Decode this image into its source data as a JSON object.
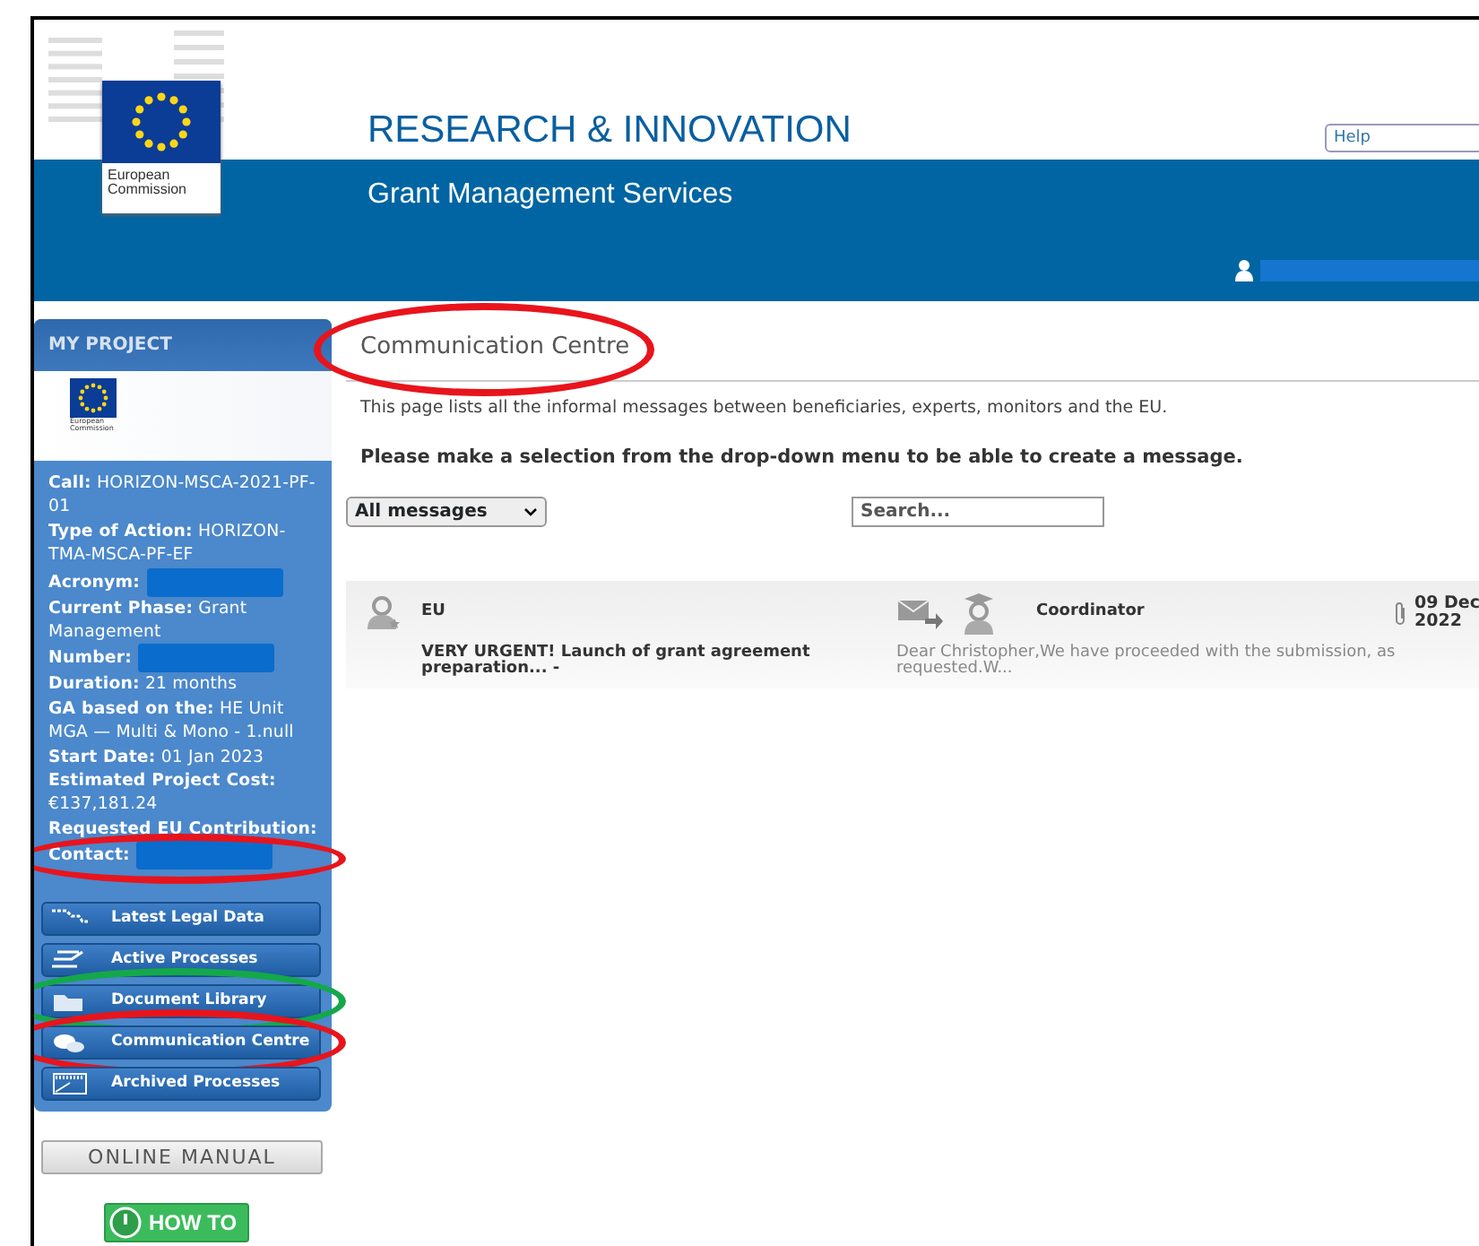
{
  "header": {
    "title": "RESEARCH & INNOVATION",
    "subtitle": "Grant Management Services",
    "logo_text": "European Commission",
    "help": "Help"
  },
  "sidebar": {
    "title": "MY PROJECT",
    "logo_text": "European Commission",
    "info": [
      {
        "text": "**Call:** HORIZON-MSCA-2021-PF-01",
        "redacted": false
      },
      {
        "text": "**Type of Action:** HORIZON-TMA-MSCA-PF-EF",
        "redacted": false
      },
      {
        "text": "**Acronym:**",
        "redacted": true
      },
      {
        "text": "**Current Phase:** Grant Management",
        "redacted": false
      },
      {
        "text": "**Number:**",
        "redacted": true
      },
      {
        "text": "**Duration:** 21 months",
        "redacted": false
      },
      {
        "text": "**GA based on the:** HE Unit MGA — Multi & Mono - 1.null",
        "redacted": false
      },
      {
        "text": "**Start Date:** 01 Jan 2023",
        "redacted": false
      },
      {
        "text": "**Estimated Project Cost:** €137,181.24",
        "redacted": false
      },
      {
        "text": "**Requested EU Contribution:**",
        "redacted": false
      },
      {
        "text": "**Contact:**",
        "redacted": true,
        "annotation": {
          "color": "#e8141c"
        }
      }
    ],
    "menu": [
      {
        "label": "Latest Legal Data",
        "kind": "legal"
      },
      {
        "label": "Active Processes",
        "kind": "process"
      },
      {
        "label": "Document Library",
        "kind": "folder",
        "annotation": {
          "color": "#14a84a"
        }
      },
      {
        "label": "Communication Centre",
        "kind": "chat",
        "annotation": {
          "color": "#e8141c"
        }
      },
      {
        "label": "Archived Processes",
        "kind": "archive"
      }
    ],
    "manual": "ONLINE MANUAL",
    "howto": "HOW TO"
  },
  "main": {
    "heading": "Communication Centre",
    "heading_annotation": {
      "color": "#e8141c"
    },
    "intro": "This page lists all the informal messages between beneficiaries, experts, monitors and the EU.",
    "instruction": "Please make a selection from the drop-down menu to be able to create a message.",
    "filter": "All messages",
    "search": {
      "placeholder": "Search..."
    },
    "messages": [
      {
        "from": "EU",
        "to": "Coordinator",
        "date": "09 Dec 2022",
        "attachment": true,
        "subject": "VERY URGENT! Launch of grant agreement preparation... -",
        "preview": "Dear Christopher,We have proceeded with the submission, as requested.W..."
      }
    ]
  }
}
